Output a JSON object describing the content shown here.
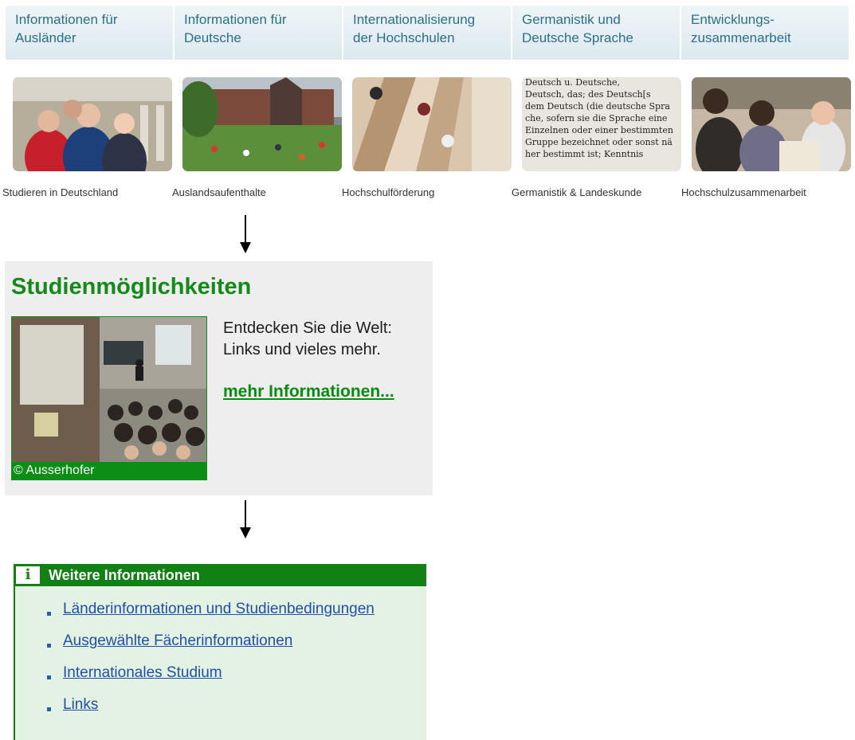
{
  "nav": {
    "items": [
      {
        "label": "Informationen für\nAusländer"
      },
      {
        "label": "Informationen für\nDeutsche"
      },
      {
        "label": "Internationalisierung\nder Hochschulen"
      },
      {
        "label": "Germanistik und\nDeutsche Sprache"
      },
      {
        "label": "Entwicklungs-\nzusammenarbeit"
      }
    ]
  },
  "captions": [
    "Studieren in Deutschland",
    "Auslandsaufenthalte",
    "Hochschulförderung",
    "Germanistik & Landeskunde",
    "Hochschulzusammenarbeit"
  ],
  "dictionary_text": [
    "Deutsch u. Deutsche,",
    "Deutsch, das; des Deutsch[s",
    "dem Deutsch (die deutsche Spra",
    "che, sofern sie die Sprache eine",
    "Einzelnen oder einer bestimmten",
    "Gruppe bezeichnet oder sonst nä",
    "her bestimmt ist; Kenntnis"
  ],
  "study": {
    "title": "Studienmöglichkeiten",
    "credit": "© Ausserhofer",
    "text_line1": "Entdecken Sie die Welt:",
    "text_line2": "Links und vieles mehr.",
    "link": "mehr Informationen..."
  },
  "info": {
    "icon_letter": "i",
    "title": "Weitere Informationen",
    "links": [
      "Länderinformationen und Studienbedingungen",
      "Ausgewählte Fächerinformationen",
      "Internationales Studium",
      "Links"
    ]
  },
  "colors": {
    "nav_text": "#2c6e8c",
    "green": "#118015",
    "link_blue": "#1f4fa8"
  }
}
